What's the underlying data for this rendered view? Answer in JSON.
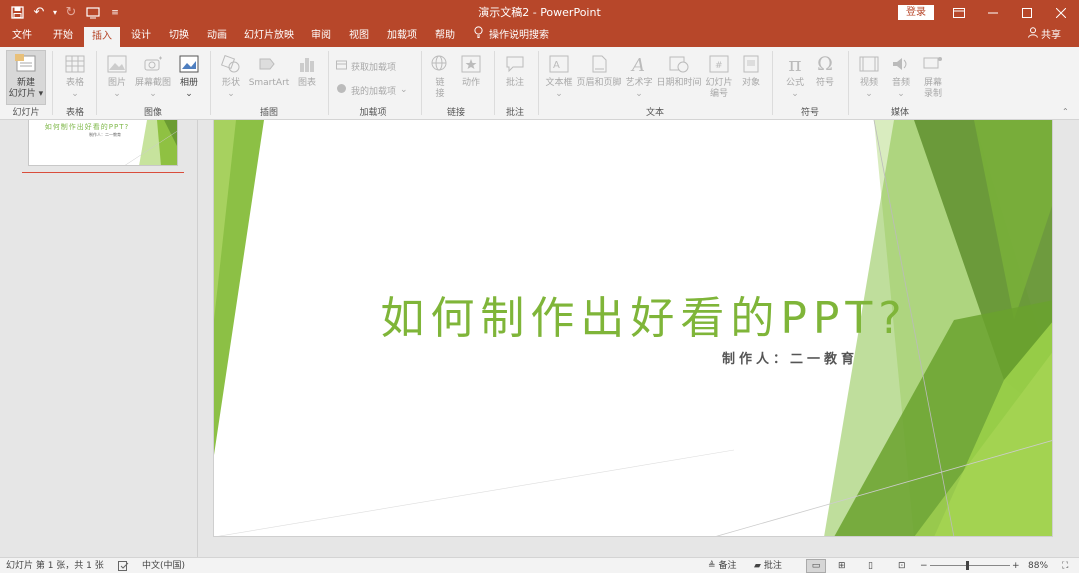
{
  "titlebar": {
    "title": "演示文稿2 - PowerPoint",
    "login": "登录",
    "bg_color": "#b7472a"
  },
  "tabs": [
    "文件",
    "开始",
    "插入",
    "设计",
    "切换",
    "动画",
    "幻灯片放映",
    "审阅",
    "视图",
    "加载项",
    "帮助"
  ],
  "active_tab": "插入",
  "tell_me": "操作说明搜索",
  "share": "共享",
  "ribbon": {
    "new_slide": {
      "line1": "新建",
      "line2": "幻灯片"
    },
    "table": "表格",
    "picture": "图片",
    "screenshot": "屏幕截图",
    "album": "相册",
    "shapes": "形状",
    "smartart": "SmartArt",
    "chart": "图表",
    "get_addins": "获取加载项",
    "my_addins": "我的加载项",
    "link": {
      "line1": "链",
      "line2": "接"
    },
    "action": "动作",
    "comment": "批注",
    "textbox": "文本框",
    "header_footer": "页眉和页脚",
    "wordart": "艺术字",
    "datetime": "日期和时间",
    "slide_number": {
      "line1": "幻灯片",
      "line2": "编号"
    },
    "object": "对象",
    "equation": "公式",
    "symbol": "符号",
    "video": "视频",
    "audio": "音频",
    "screen_record": {
      "line1": "屏幕",
      "line2": "录制"
    },
    "groups": {
      "slides": "幻灯片",
      "tables": "表格",
      "images": "图像",
      "illustrations": "插图",
      "addins": "加载项",
      "links": "链接",
      "comments": "批注",
      "text": "文本",
      "symbols": "符号",
      "media": "媒体"
    }
  },
  "thumbnail": {
    "title": "如何制作出好看的PPT?",
    "subtitle": "制作人：二一教育"
  },
  "slide": {
    "title": "如何制作出好看的PPT?",
    "subtitle": "制作人：二一教育",
    "accent_color": "#7fb539"
  },
  "status": {
    "slide_info": "幻灯片 第 1 张，共 1 张",
    "language": "中文(中国)",
    "notes": "备注",
    "comments": "批注",
    "zoom": "88%",
    "minus": "−",
    "plus": "+"
  }
}
